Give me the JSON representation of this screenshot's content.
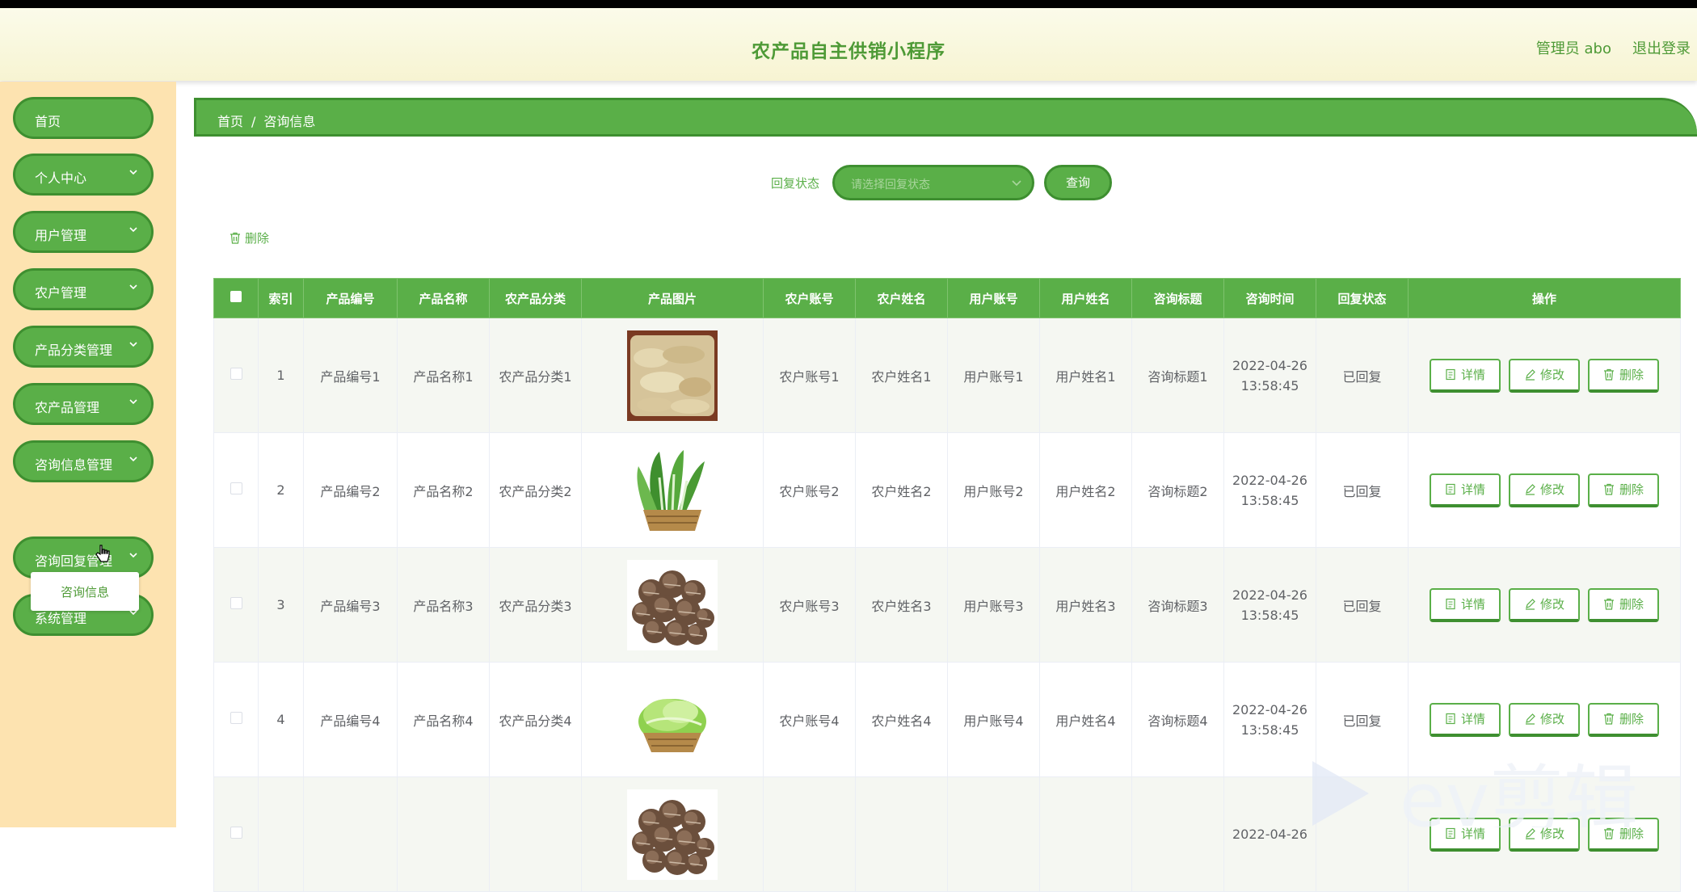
{
  "header": {
    "title": "农产品自主供销小程序",
    "user": "管理员 abo",
    "logout": "退出登录"
  },
  "sidebar": {
    "items": [
      {
        "label": "首页",
        "has_chevron": false
      },
      {
        "label": "个人中心",
        "has_chevron": true
      },
      {
        "label": "用户管理",
        "has_chevron": true
      },
      {
        "label": "农户管理",
        "has_chevron": true
      },
      {
        "label": "产品分类管理",
        "has_chevron": true
      },
      {
        "label": "农产品管理",
        "has_chevron": true
      },
      {
        "label": "咨询信息管理",
        "has_chevron": true
      },
      {
        "label": "咨询回复管理",
        "has_chevron": true
      },
      {
        "label": "系统管理",
        "has_chevron": true
      }
    ],
    "submenu": {
      "label": "咨询信息"
    }
  },
  "breadcrumb": {
    "home": "首页",
    "sep": "/",
    "current": "咨询信息"
  },
  "search": {
    "label": "回复状态",
    "placeholder": "请选择回复状态",
    "button": "查询"
  },
  "actions": {
    "delete": "删除"
  },
  "table": {
    "headers": [
      "索引",
      "产品编号",
      "产品名称",
      "农产品分类",
      "产品图片",
      "农户账号",
      "农户姓名",
      "用户账号",
      "用户姓名",
      "咨询标题",
      "咨询时间",
      "回复状态",
      "操作"
    ],
    "op_labels": {
      "detail": "详情",
      "edit": "修改",
      "delete": "删除"
    },
    "rows": [
      {
        "index": "1",
        "code": "产品编号1",
        "name": "产品名称1",
        "category": "农产品分类1",
        "image": "ginger",
        "farmer_account": "农户账号1",
        "farmer_name": "农户姓名1",
        "user_account": "用户账号1",
        "user_name": "用户姓名1",
        "title": "咨询标题1",
        "date": "2022-04-26",
        "time": "13:58:45",
        "status": "已回复"
      },
      {
        "index": "2",
        "code": "产品编号2",
        "name": "产品名称2",
        "category": "农产品分类2",
        "image": "greens",
        "farmer_account": "农户账号2",
        "farmer_name": "农户姓名2",
        "user_account": "用户账号2",
        "user_name": "用户姓名2",
        "title": "咨询标题2",
        "date": "2022-04-26",
        "time": "13:58:45",
        "status": "已回复"
      },
      {
        "index": "3",
        "code": "产品编号3",
        "name": "产品名称3",
        "category": "农产品分类3",
        "image": "mushrooms",
        "farmer_account": "农户账号3",
        "farmer_name": "农户姓名3",
        "user_account": "用户账号3",
        "user_name": "用户姓名3",
        "title": "咨询标题3",
        "date": "2022-04-26",
        "time": "13:58:45",
        "status": "已回复"
      },
      {
        "index": "4",
        "code": "产品编号4",
        "name": "产品名称4",
        "category": "农产品分类4",
        "image": "lettuce",
        "farmer_account": "农户账号4",
        "farmer_name": "农户姓名4",
        "user_account": "用户账号4",
        "user_name": "用户姓名4",
        "title": "咨询标题4",
        "date": "2022-04-26",
        "time": "13:58:45",
        "status": "已回复"
      },
      {
        "index": "",
        "code": "",
        "name": "",
        "category": "",
        "image": "mushrooms",
        "farmer_account": "",
        "farmer_name": "",
        "user_account": "",
        "user_name": "",
        "title": "",
        "date": "2022-04-26",
        "time": "",
        "status": ""
      }
    ]
  },
  "watermark": {
    "text": "ev剪辑"
  },
  "colors": {
    "primary": "#5aaf48",
    "primary_dark": "#3e8f30",
    "sidebar_bg": "#fde3b0",
    "header_bg": "#f9f7dd"
  }
}
